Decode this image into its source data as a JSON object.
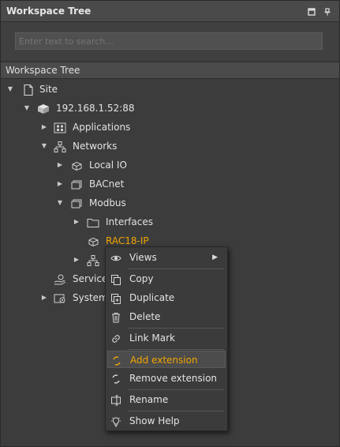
{
  "panel": {
    "title": "Workspace Tree",
    "pin_icon": "pin-icon",
    "restore_icon": "restore-window-icon"
  },
  "search": {
    "placeholder": "Enter text to search..."
  },
  "section": {
    "title": "Workspace Tree"
  },
  "tree": {
    "site": "Site",
    "server": "192.168.1.52:88",
    "applications": "Applications",
    "networks": "Networks",
    "local_io": "Local IO",
    "bacnet": "BACnet",
    "modbus": "Modbus",
    "interfaces": "Interfaces",
    "rac18": "RAC18-IP",
    "services": "Services",
    "system": "System"
  },
  "context_menu": {
    "views": "Views",
    "copy": "Copy",
    "duplicate": "Duplicate",
    "delete": "Delete",
    "link_mark": "Link Mark",
    "add_extension": "Add extension",
    "remove_extension": "Remove extension",
    "rename": "Rename",
    "show_help": "Show Help"
  },
  "colors": {
    "background": "#3c3c3c",
    "accent": "#f0a500",
    "text": "#e2e2e2"
  }
}
